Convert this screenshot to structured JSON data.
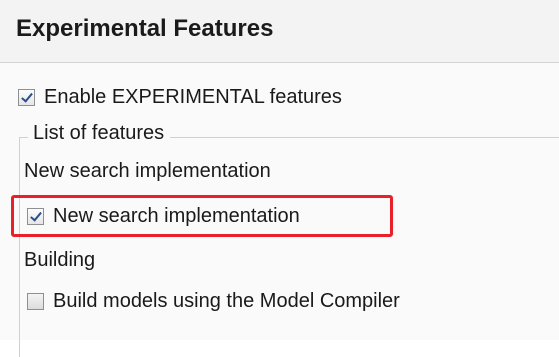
{
  "page": {
    "title": "Experimental Features"
  },
  "enable_experimental": {
    "label": "Enable EXPERIMENTAL features",
    "checked": true
  },
  "features_group": {
    "legend": "List of features",
    "sections": [
      {
        "heading": "New search implementation",
        "option": {
          "label": "New search implementation",
          "checked": true,
          "highlighted": true
        }
      },
      {
        "heading": "Building",
        "option": {
          "label": "Build models using the Model Compiler",
          "checked": false,
          "highlighted": false
        }
      }
    ]
  },
  "colors": {
    "highlight": "#e8202a",
    "checkmark": "#2a4f8a"
  }
}
